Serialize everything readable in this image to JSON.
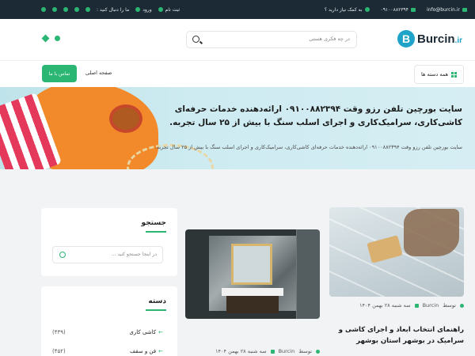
{
  "topbar": {
    "email": "info@burcin.ir",
    "phone": "۰۹۱۰۰۸۸۲۳۹۴",
    "help": "به کمک نیاز دارید ؟",
    "register": "ثبت نام",
    "login": "ورود",
    "join_us": "ما را دنبال کنید :"
  },
  "header": {
    "logo_main": "Burcin",
    "logo_suffix": ".ir",
    "logo_badge": "B",
    "search_placeholder": "در چه فکری هستی"
  },
  "nav": {
    "all_categories": "همه دسته ها",
    "home": "صفحه اصلی",
    "contact": "تماس با ما"
  },
  "banner": {
    "title": "سایت بورچین تلفن رزو وقت ۰۹۱۰۰۸۸۲۳۹۴ ارائه‌دهنده خدمات حرفه‌ای کاشی‌کاری، سرامیک‌کاری و اجرای اسلب سنگ با بیش از ۲۵ سال تجربه.",
    "subtitle": "سایت بورچین تلفن رزو وقت ۰۹۱۰۰۸۸۲۳۹۴ ارائه‌دهنده خدمات حرفه‌ای کاشی‌کاری، سرامیک‌کاری و اجرای اسلب سنگ با بیش از ۲۵ سال تجربه."
  },
  "sidebar": {
    "search_title": "جستجو",
    "search_placeholder": "در اینجا جستجو کنید ...",
    "categories_title": "دسته",
    "categories": [
      {
        "name": "کاشی کاری",
        "count": "(۴۳۹)"
      },
      {
        "name": "فن و سقف",
        "count": "(۴۵۲)"
      }
    ]
  },
  "posts": [
    {
      "author": "Burcin",
      "author_prefix": "توسط",
      "date": "سه شنبه ۲۸ بهمن ۱۴۰۴",
      "title": "راهنمای انتخاب ابعاد و اجرای کاشی و سرامیک در بوشهر استان بوشهر"
    },
    {
      "author": "Burcin",
      "author_prefix": "توسط",
      "date": "سه شنبه ۲۸ بهمن ۱۴۰۴",
      "title": ""
    }
  ],
  "colors": {
    "accent": "#2bb673",
    "topbar": "#1c2a35",
    "brand": "#1fa3c9"
  }
}
